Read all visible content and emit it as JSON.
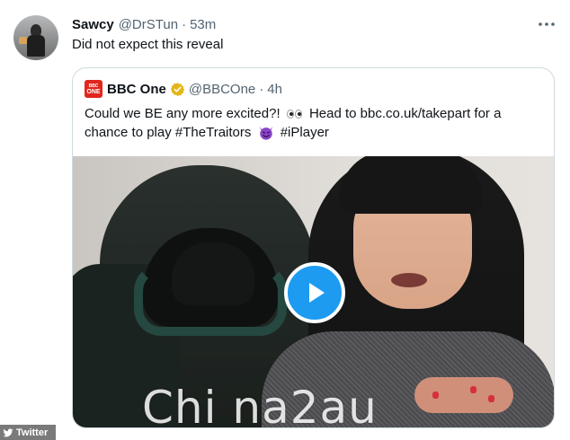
{
  "tweet": {
    "display_name": "Sawcy",
    "handle": "@DrSTun",
    "separator": "·",
    "time": "53m",
    "text": "Did not expect this reveal",
    "more_icon": "more-horizontal-icon"
  },
  "quoted": {
    "logo_text_top": "BBC",
    "logo_text_bottom": "ONE",
    "display_name": "BBC One",
    "verified_icon": "verified-gold-badge-icon",
    "handle": "@BBCOne",
    "separator": "·",
    "time": "4h",
    "text_part1": "Could we BE any more excited?!",
    "text_part2": "Head to bbc.co.uk/takepart for a",
    "text_line2_part1": "chance to play #TheTraitors",
    "text_line2_part2": "#iPlayer",
    "emoji_eyes": "eyes-emoji-icon",
    "emoji_devil": "smiling-devil-emoji-icon",
    "media": {
      "type": "video",
      "play_icon": "play-icon"
    }
  },
  "watermark": "Chi na2au",
  "badge": {
    "label": "Twitter",
    "icon": "twitter-bird-icon"
  },
  "colors": {
    "accent": "#1d9bf0",
    "verified_gold": "#e2b719",
    "bbc_red": "#e1261c",
    "devil_purple": "#8a44c8"
  }
}
